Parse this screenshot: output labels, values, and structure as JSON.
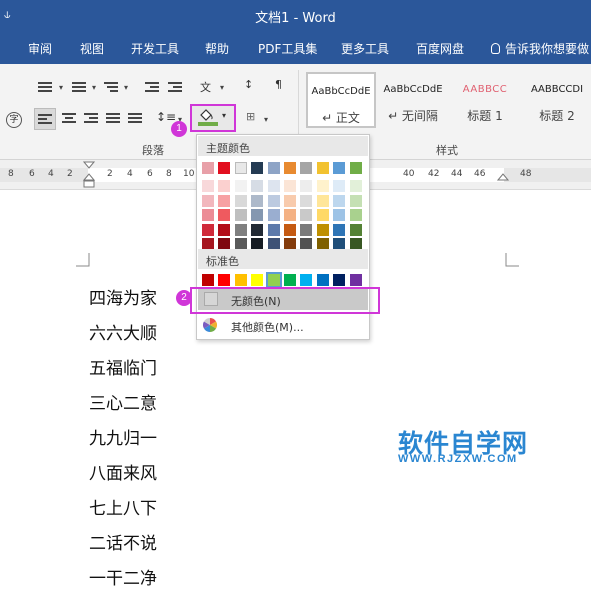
{
  "window": {
    "title": "文档1  -  Word",
    "quick_access": "⫝"
  },
  "ribbon_tabs": [
    "审阅",
    "视图",
    "开发工具",
    "帮助",
    "PDF工具集",
    "更多工具",
    "百度网盘"
  ],
  "tell_me": "告诉我你想要做",
  "groups": {
    "paragraph_label": "段落",
    "styles_label": "样式"
  },
  "styles": [
    {
      "sample": "AaBbCcDdE",
      "name": "↵ 正文"
    },
    {
      "sample": "AaBbCcDdE",
      "name": "↵ 无间隔"
    },
    {
      "sample": "AABBCC",
      "name": "标题 1"
    },
    {
      "sample": "AABBCCDI",
      "name": "标题 2"
    }
  ],
  "ruler_numbers": [
    "8",
    "6",
    "4",
    "2",
    "2",
    "4",
    "6",
    "8",
    "10",
    "40",
    "42",
    "44",
    "46",
    "48"
  ],
  "shading_menu": {
    "theme_colors_label": "主题颜色",
    "standard_colors_label": "标准色",
    "no_color_label": "无颜色(N)",
    "more_colors_label": "其他颜色(M)...",
    "theme_top_row": [
      "#e8a0a8",
      "#e20f1f",
      "#e8e8e8",
      "#243b53",
      "#8ea4c6",
      "#e88a30",
      "#a5a5a5",
      "#f2c230",
      "#5b9bd5",
      "#70ad47"
    ],
    "theme_columns": [
      [
        "#f8d8da",
        "#f2b7bd",
        "#ec8c96",
        "#d02a3a",
        "#a6151f"
      ],
      [
        "#fbd0cf",
        "#f7a1a3",
        "#ef5a5f",
        "#b30d18",
        "#7f0810"
      ],
      [
        "#f2f2f2",
        "#d9d9d9",
        "#bfbfbf",
        "#7f7f7f",
        "#595959"
      ],
      [
        "#d6dce5",
        "#adb9ca",
        "#8497b0",
        "#222a35",
        "#161c23"
      ],
      [
        "#dde4ef",
        "#bccae0",
        "#9aaed0",
        "#5d7aab",
        "#3e5276"
      ],
      [
        "#fbe5d6",
        "#f8cbad",
        "#f4b183",
        "#c55a11",
        "#843c0c"
      ],
      [
        "#ededed",
        "#dbdbdb",
        "#c9c9c9",
        "#7b7b7b",
        "#525252"
      ],
      [
        "#fff2cc",
        "#ffe699",
        "#ffd966",
        "#bf9000",
        "#7f6000"
      ],
      [
        "#deebf7",
        "#bdd7ee",
        "#9dc3e6",
        "#2e75b6",
        "#1f4e79"
      ],
      [
        "#e2f0d9",
        "#c5e0b4",
        "#a9d18e",
        "#548235",
        "#385723"
      ]
    ],
    "standard_row": [
      "#c00000",
      "#ff0000",
      "#ffc000",
      "#ffff00",
      "#92d050",
      "#00b050",
      "#00b0f0",
      "#0070c0",
      "#002060",
      "#7030a0"
    ],
    "selected_standard_index": 4
  },
  "annotations": {
    "badge1": "1",
    "badge2": "2"
  },
  "document_lines": [
    "四海为家",
    "六六大顺",
    "五福临门",
    "三心二意",
    "九九归一",
    "八面来风",
    "七上八下",
    "二话不说",
    "一干二净"
  ],
  "watermark": {
    "main": "软件自学网",
    "sub": "WWW.RJZXW.COM"
  }
}
